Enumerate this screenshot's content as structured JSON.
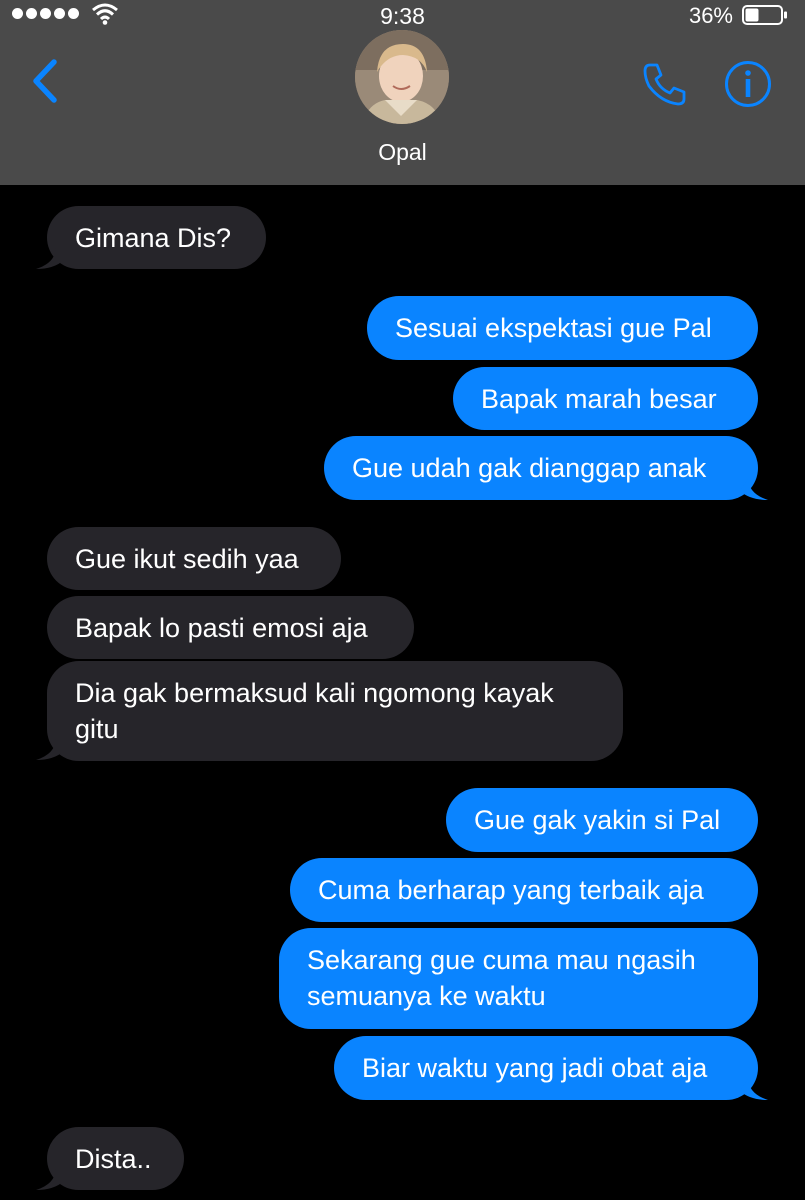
{
  "status_bar": {
    "time": "9:38",
    "battery": "36%"
  },
  "header": {
    "contact_name": "Opal"
  },
  "messages": [
    {
      "from": "them",
      "text": "Gimana Dis?"
    },
    {
      "from": "me",
      "text": "Sesuai ekspektasi gue Pal"
    },
    {
      "from": "me",
      "text": "Bapak marah besar"
    },
    {
      "from": "me",
      "text": "Gue udah gak dianggap anak"
    },
    {
      "from": "them",
      "text": "Gue ikut sedih yaa"
    },
    {
      "from": "them",
      "text": "Bapak lo pasti emosi aja"
    },
    {
      "from": "them",
      "text": "Dia gak bermaksud kali ngomong kayak gitu"
    },
    {
      "from": "me",
      "text": "Gue gak yakin si Pal"
    },
    {
      "from": "me",
      "text": "Cuma berharap yang terbaik aja"
    },
    {
      "from": "me",
      "text": "Sekarang gue cuma mau ngasih semuanya ke waktu"
    },
    {
      "from": "me",
      "text": "Biar waktu yang jadi obat aja"
    },
    {
      "from": "them",
      "text": "Dista.."
    }
  ],
  "colors": {
    "header_bg": "#4a4a4a",
    "outgoing": "#0a84ff",
    "incoming": "#26252a",
    "accent": "#0a84ff"
  },
  "icons": [
    "back-chevron-icon",
    "phone-icon",
    "info-icon",
    "wifi-icon",
    "battery-icon"
  ]
}
